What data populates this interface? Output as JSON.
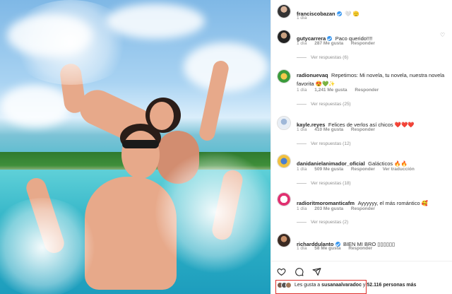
{
  "post": {
    "author": "franciscobazan",
    "author_age": "1 día",
    "author_emoji": "🤍 🫡"
  },
  "comments": [
    {
      "user": "gutycarrera",
      "verified": true,
      "text": "Paco querido!!!!",
      "age": "1 día",
      "likes": "287 Me gusta",
      "reply": "Responder",
      "translate": "",
      "replies": "Ver respuestas (6)"
    },
    {
      "user": "radionuevaq",
      "verified": false,
      "text": "Repetimos: Mi novela, tu novela, nuestra novela favorita 😍💚✨",
      "age": "1 día",
      "likes": "1,241 Me gusta",
      "reply": "Responder",
      "translate": "",
      "replies": "Ver respuestas (25)"
    },
    {
      "user": "kayle.reyes",
      "verified": false,
      "text": "Felices de verlos así chicos ❤️❤️❤️",
      "age": "1 día",
      "likes": "410 Me gusta",
      "reply": "Responder",
      "translate": "",
      "replies": "Ver respuestas (12)"
    },
    {
      "user": "danidanielanimador_oficial",
      "verified": false,
      "text": "Galácticos 🔥🔥",
      "age": "1 día",
      "likes": "509 Me gusta",
      "reply": "Responder",
      "translate": "Ver traducción",
      "replies": "Ver respuestas (18)"
    },
    {
      "user": "radioritmoromanticafm",
      "verified": false,
      "text": "Ayyyyyy, el más romántico 🥰",
      "age": "1 día",
      "likes": "203 Me gusta",
      "reply": "Responder",
      "translate": "",
      "replies": "Ver respuestas (2)"
    },
    {
      "user": "richarddulanto",
      "verified": true,
      "text": "BIEN MI BRO ▯▯▯▯▯▯",
      "age": "1 día",
      "likes": "58 Me gusta",
      "reply": "Responder",
      "translate": "",
      "replies": ""
    }
  ],
  "likes_line": {
    "prefix": "Les gusta a",
    "user": "susanaalvaradoc",
    "suffix": "y",
    "count": "52.116 personas más"
  },
  "colors": {
    "verified": "#3897f0",
    "highlight": "#e0302a",
    "meta_gray": "#8e8e8e"
  },
  "icons": [
    "heart-icon",
    "comment-icon",
    "share-icon"
  ]
}
